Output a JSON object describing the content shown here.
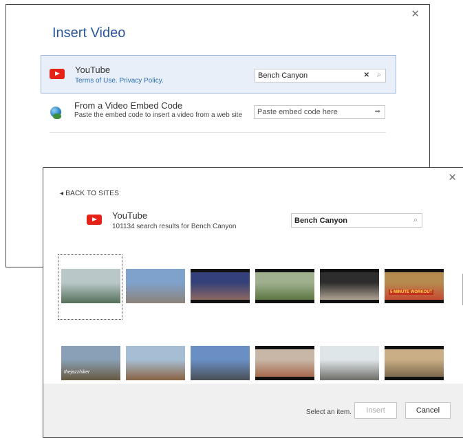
{
  "dialog1": {
    "title": "Insert Video",
    "close": "✕",
    "youtube": {
      "name": "YouTube",
      "terms_link": "Terms of Use.",
      "privacy_link": "Privacy Policy.",
      "search_value": "Bench Canyon",
      "clear_glyph": "✕",
      "search_glyph": "⌕"
    },
    "embed": {
      "name": "From a Video Embed Code",
      "description": "Paste the embed code to insert a video from a web site",
      "placeholder": "Paste embed code here",
      "go_glyph": "➡"
    }
  },
  "dialog2": {
    "close": "✕",
    "back_label": "◂ BACK TO SITES",
    "service_name": "YouTube",
    "result_count": "101134 search results for Bench Canyon",
    "search_value": "Bench Canyon",
    "search_glyph": "⌕",
    "scroll_up_glyph": "⌃",
    "scroll_down_glyph": "⌄",
    "thumbnails": [
      {
        "label": "",
        "top": "#b9c7c9",
        "bottom": "#55705a",
        "sky": true
      },
      {
        "label": "",
        "top": "#7fa2cc",
        "bottom": "#8c8278",
        "sky": true
      },
      {
        "label": "",
        "top": "#34407a",
        "bottom": "#9e6f5a",
        "sky": false
      },
      {
        "label": "",
        "top": "#9fb08f",
        "bottom": "#4f6a32",
        "sky": false
      },
      {
        "label": "",
        "top": "#2d2d2d",
        "bottom": "#c9b9a6",
        "sky": false
      },
      {
        "label": "5 MINUTE WORKOUT",
        "top": "#b58b4f",
        "bottom": "#c93d2d",
        "sky": false
      },
      {
        "label": "thejazzhiker",
        "top": "#8aa0b6",
        "bottom": "#66583f",
        "sky": true
      },
      {
        "label": "",
        "top": "#a6bed4",
        "bottom": "#8a6242",
        "sky": true
      },
      {
        "label": "",
        "top": "#6a8fc4",
        "bottom": "#4a4f56",
        "sky": true
      },
      {
        "label": "",
        "top": "#c8b7a7",
        "bottom": "#a0593a",
        "sky": false
      },
      {
        "label": "",
        "top": "#dfe6ea",
        "bottom": "#6d6d67",
        "sky": true
      },
      {
        "label": "",
        "top": "#c9ae86",
        "bottom": "#6c5a3f",
        "sky": false
      }
    ],
    "footer": {
      "status": "Select an item.",
      "insert_label": "Insert",
      "cancel_label": "Cancel"
    }
  }
}
